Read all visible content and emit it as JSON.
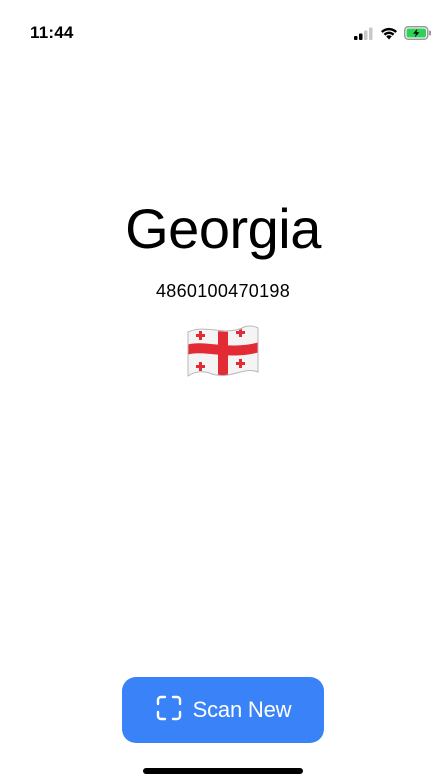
{
  "status_bar": {
    "time": "11:44",
    "icons": [
      "cellular-signal-icon",
      "wifi-icon",
      "battery-charging-icon"
    ],
    "battery_color": "#30d158"
  },
  "result": {
    "country": "Georgia",
    "barcode": "4860100470198",
    "flag": "georgia-flag-icon"
  },
  "actions": {
    "scan_new_label": "Scan New",
    "scan_icon": "scan-frame-icon",
    "accent_color": "#3a82f7"
  }
}
